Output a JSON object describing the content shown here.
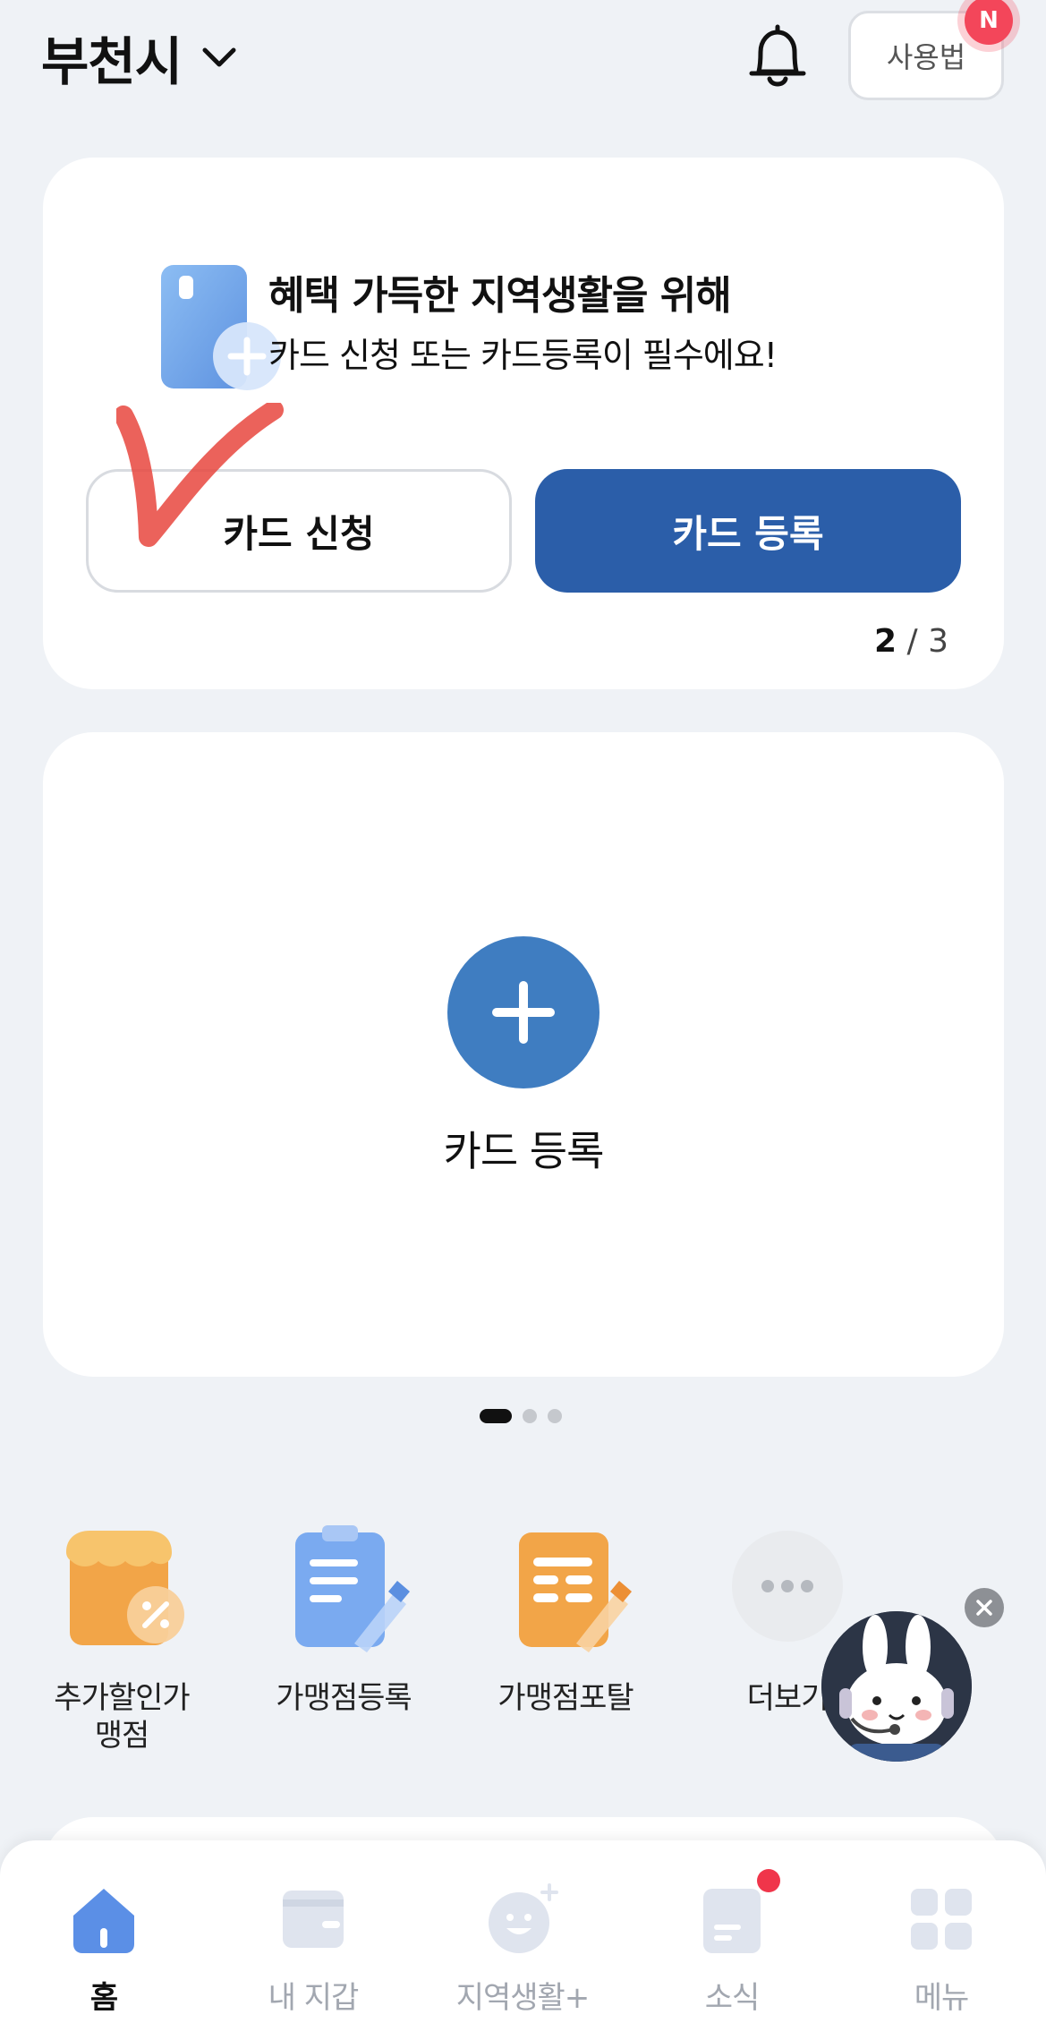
{
  "header": {
    "city": "부천시",
    "howto_label": "사용법",
    "new_badge": "N"
  },
  "promo_card": {
    "title": "혜택 가득한 지역생활을 위해",
    "subtitle": "카드 신청 또는 카드등록이 필수에요!",
    "apply_button": "카드 신청",
    "register_button": "카드 등록",
    "page_current": "2",
    "page_sep": "/",
    "page_total": "3"
  },
  "card_add": {
    "label": "카드 등록"
  },
  "carousel": {
    "active_index": 0,
    "count": 3
  },
  "quick_menu": [
    {
      "label": "추가할인가\n맹점",
      "icon": "store-discount-icon"
    },
    {
      "label": "가맹점등록",
      "icon": "clipboard-edit-icon"
    },
    {
      "label": "가맹점포탈",
      "icon": "portal-edit-icon"
    },
    {
      "label": "더보기",
      "icon": "more-dots-icon"
    }
  ],
  "bottom_nav": [
    {
      "label": "홈",
      "icon": "home-icon",
      "active": true
    },
    {
      "label": "내 지갑",
      "icon": "wallet-icon",
      "active": false
    },
    {
      "label": "지역생활+",
      "icon": "smile-plus-icon",
      "active": false
    },
    {
      "label": "소식",
      "icon": "news-icon",
      "active": false,
      "badge": true
    },
    {
      "label": "메뉴",
      "icon": "menu-grid-icon",
      "active": false
    }
  ],
  "colors": {
    "primary": "#2b5ea9",
    "add_circle": "#3f7dc1",
    "badge_red": "#f3465a",
    "background": "#eff2f6",
    "annotation_red": "#e8473e"
  }
}
